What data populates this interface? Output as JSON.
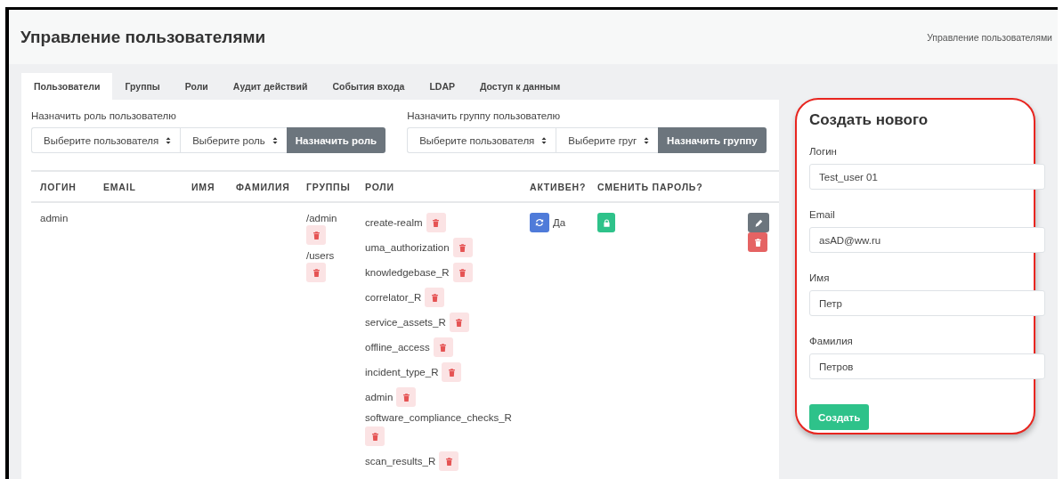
{
  "header": {
    "title": "Управление пользователями",
    "breadcrumb": "Управление пользователями"
  },
  "tabs": [
    {
      "label": "Пользователи",
      "selected": true
    },
    {
      "label": "Группы",
      "selected": false
    },
    {
      "label": "Роли",
      "selected": false
    },
    {
      "label": "Аудит действий",
      "selected": false
    },
    {
      "label": "События входа",
      "selected": false
    },
    {
      "label": "LDAP",
      "selected": false
    },
    {
      "label": "Доступ к данным",
      "selected": false
    }
  ],
  "assign_role": {
    "label": "Назначить роль пользователю",
    "selects": [
      "Выберите пользователя",
      "Выберите роль"
    ],
    "button": "Назначить роль"
  },
  "assign_group": {
    "label": "Назначить группу пользователю",
    "selects": [
      "Выберите пользователя",
      "Выберите груг"
    ],
    "button": "Назначить группу"
  },
  "table": {
    "columns": [
      "ЛОГИН",
      "EMAIL",
      "ИМЯ",
      "ФАМИЛИЯ",
      "ГРУППЫ",
      "РОЛИ",
      "АКТИВЕН?",
      "СМЕНИТЬ ПАРОЛЬ?"
    ],
    "rows": [
      {
        "login": "admin",
        "groups": [
          "/admin",
          "/users"
        ],
        "roles": [
          "create-realm",
          "uma_authorization",
          "knowledgebase_R",
          "correlator_R",
          "service_assets_R",
          "offline_access",
          "incident_type_R",
          "admin",
          "software_compliance_checks_R",
          "scan_results_R"
        ],
        "active": "Да"
      }
    ]
  },
  "create_form": {
    "title": "Создать нового",
    "fields": [
      {
        "label": "Логин",
        "value": "Test_user 01"
      },
      {
        "label": "Email",
        "value": "asAD@ww.ru"
      },
      {
        "label": "Имя",
        "value": "Петр"
      },
      {
        "label": "Фамилия",
        "value": "Петров"
      }
    ],
    "button": "Создать"
  }
}
